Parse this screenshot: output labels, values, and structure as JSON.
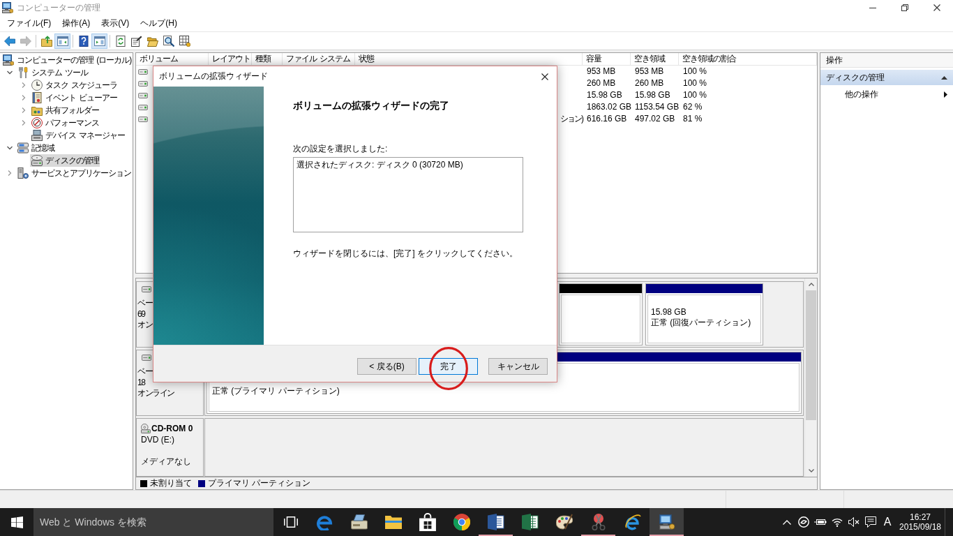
{
  "window": {
    "title": "コンピューターの管理"
  },
  "menu": [
    {
      "label": "ファイル(F)"
    },
    {
      "label": "操作(A)"
    },
    {
      "label": "表示(V)"
    },
    {
      "label": "ヘルプ(H)"
    }
  ],
  "toolbar": [
    [
      {
        "kind": "back",
        "disabled": false,
        "pressed": false
      },
      {
        "kind": "forward",
        "disabled": true,
        "pressed": false
      }
    ],
    [
      {
        "kind": "up",
        "disabled": false,
        "pressed": false
      },
      {
        "kind": "console-tree",
        "disabled": false,
        "pressed": true
      }
    ],
    [
      {
        "kind": "help",
        "disabled": false,
        "pressed": false
      },
      {
        "kind": "action-pane",
        "disabled": false,
        "pressed": true
      }
    ],
    [
      {
        "kind": "refresh",
        "disabled": false,
        "pressed": false
      },
      {
        "kind": "properties",
        "disabled": false,
        "pressed": false
      },
      {
        "kind": "open",
        "disabled": false,
        "pressed": false
      },
      {
        "kind": "find",
        "disabled": false,
        "pressed": false
      },
      {
        "kind": "export",
        "disabled": false,
        "pressed": false
      }
    ]
  ],
  "tree": [
    {
      "label": "コンピューターの管理 (ローカル)",
      "kind": "computer",
      "selected": false,
      "children": [
        {
          "label": "システム ツール",
          "kind": "tools",
          "selected": false,
          "expanded": true,
          "children": [
            {
              "label": "タスク スケジューラ",
              "kind": "clock",
              "selected": false,
              "expanded": false
            },
            {
              "label": "イベント ビューアー",
              "kind": "event-log",
              "selected": false,
              "expanded": false
            },
            {
              "label": "共有フォルダー",
              "kind": "shared-folder",
              "selected": false,
              "expanded": false
            },
            {
              "label": "パフォーマンス",
              "kind": "performance",
              "selected": false,
              "expanded": false
            },
            {
              "label": "デバイス マネージャー",
              "kind": "device-manager",
              "selected": false
            }
          ]
        },
        {
          "label": "記憶域",
          "kind": "storage",
          "selected": false,
          "expanded": true,
          "children": [
            {
              "label": "ディスクの管理",
              "kind": "disk",
              "selected": true
            }
          ]
        },
        {
          "label": "サービスとアプリケーション",
          "kind": "services",
          "selected": false,
          "expanded": false
        }
      ]
    }
  ],
  "volume_list": {
    "columns": [
      "ボリューム",
      "レイアウト",
      "種類",
      "ファイル システム",
      "状態",
      "容量",
      "空き領域",
      "空き領域の割合"
    ],
    "rows": [
      {
        "capacity": "953 MB",
        "free": "953 MB",
        "percent": "100 %"
      },
      {
        "capacity": "260 MB",
        "free": "260 MB",
        "percent": "100 %"
      },
      {
        "capacity": "15.98 GB",
        "free": "15.98 GB",
        "percent": "100 %"
      },
      {
        "capacity": "1863.02 GB",
        "free": "1153.54 GB",
        "percent": "62 %"
      },
      {
        "status": "ション)",
        "capacity": "616.16 GB",
        "free": "497.02 GB",
        "percent": "81 %"
      }
    ]
  },
  "disks": [
    {
      "kind": "disk",
      "type": "ベー",
      "size": "69",
      "status": "オン",
      "partitions": [
        {
          "color": "#000000"
        },
        {
          "color": "#000080",
          "size": "15.98 GB",
          "status": "正常 (回復パーティション)"
        }
      ]
    },
    {
      "kind": "disk",
      "type": "ベー",
      "size": "18",
      "status": "オンライン",
      "partitions": [
        {
          "color": "#000080",
          "status": "正常 (プライマリ パーティション)"
        }
      ]
    },
    {
      "kind": "cdrom",
      "name": "CD-ROM 0",
      "type": "DVD (E:)",
      "status": "メディアなし"
    }
  ],
  "legend": [
    {
      "label": "未割り当て",
      "color": "#000000"
    },
    {
      "label": "プライマリ パーティション",
      "color": "#000080"
    }
  ],
  "actions": {
    "title": "操作",
    "items": [
      {
        "kind": "group",
        "label": "ディスクの管理",
        "expanded": true
      },
      {
        "kind": "submenu",
        "label": "他の操作"
      }
    ]
  },
  "dialog": {
    "title": "ボリュームの拡張ウィザード",
    "heading": "ボリュームの拡張ウィザードの完了",
    "prompt": "次の設定を選択しました:",
    "summary": "選択されたディスク: ディスク 0 (30720 MB)",
    "instruction": "ウィザードを閉じるには、[完了] をクリックしてください。",
    "buttons": [
      {
        "label": "< 戻る(B)",
        "default": false,
        "highlighted": false
      },
      {
        "label": "完了",
        "default": true,
        "highlighted": true
      },
      {
        "label": "キャンセル",
        "default": false,
        "highlighted": false
      }
    ]
  },
  "taskbar": {
    "search": {
      "placeholder": "Web と Windows を検索"
    },
    "apps": [
      {
        "kind": "task-view",
        "running": false,
        "active": false
      },
      {
        "kind": "edge",
        "running": false,
        "active": false
      },
      {
        "kind": "scanner",
        "running": false,
        "active": false
      },
      {
        "kind": "folder",
        "running": false,
        "active": false
      },
      {
        "kind": "store",
        "running": false,
        "active": false
      },
      {
        "kind": "chrome",
        "running": false,
        "active": false
      },
      {
        "kind": "word",
        "running": true,
        "active": false
      },
      {
        "kind": "excel",
        "running": false,
        "active": false
      },
      {
        "kind": "paint",
        "running": false,
        "active": false
      },
      {
        "kind": "snipping",
        "running": true,
        "active": false
      },
      {
        "kind": "ie",
        "running": false,
        "active": false
      },
      {
        "kind": "computer",
        "running": true,
        "active": true
      }
    ],
    "tray": [
      {
        "kind": "chevron"
      },
      {
        "kind": "swirl"
      },
      {
        "kind": "battery"
      },
      {
        "kind": "wifi"
      },
      {
        "kind": "muted-speaker"
      },
      {
        "kind": "notification"
      }
    ],
    "ime": "A",
    "time": "16:27",
    "date": "2015/09/18"
  }
}
